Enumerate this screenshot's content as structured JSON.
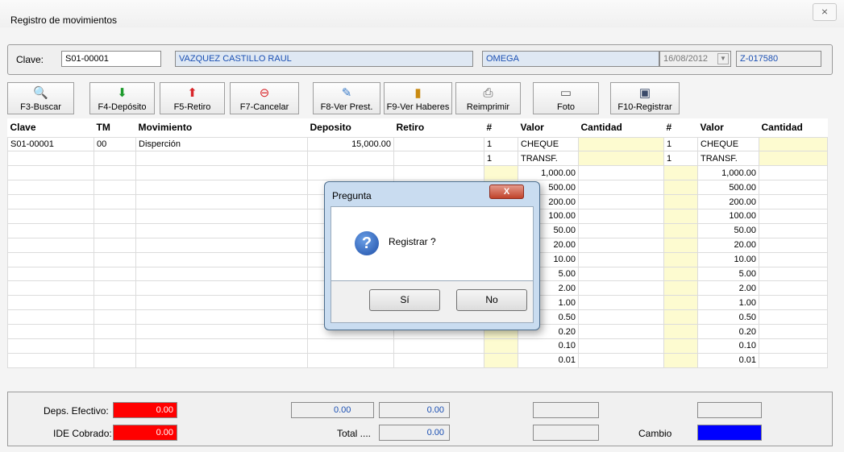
{
  "window": {
    "title": "Registro de movimientos",
    "close_glyph": "⨯"
  },
  "header": {
    "clave_label": "Clave:",
    "clave_value": "S01-00001",
    "name": "VAZQUEZ CASTILLO RAUL",
    "branch": "OMEGA",
    "date": "16/08/2012",
    "code": "Z-017580"
  },
  "toolbar": [
    {
      "label": "F3-Buscar",
      "icon": "search-icon",
      "glyph": "🔍"
    },
    {
      "label": "F4-Depósito",
      "icon": "arrow-down-icon",
      "glyph": "⬇"
    },
    {
      "label": "F5-Retiro",
      "icon": "arrow-up-icon",
      "glyph": "⬆"
    },
    {
      "label": "F7-Cancelar",
      "icon": "cancel-icon",
      "glyph": "⊖"
    },
    {
      "label": "F8-Ver Prest.",
      "icon": "document-icon",
      "glyph": "✎"
    },
    {
      "label": "F9-Ver Haberes",
      "icon": "bar-chart-icon",
      "glyph": "▮"
    },
    {
      "label": "Reimprimir",
      "icon": "printer-icon",
      "glyph": "⎙"
    },
    {
      "label": "Foto",
      "icon": "camera-icon",
      "glyph": "▭"
    },
    {
      "label": "F10-Registrar",
      "icon": "save-icon",
      "glyph": "▣"
    }
  ],
  "grid": {
    "columns": [
      "Clave",
      "TM",
      "Movimiento",
      "Deposito",
      "Retiro",
      "#",
      "Valor",
      "Cantidad",
      "#",
      "Valor",
      "Cantidad"
    ],
    "rows": [
      {
        "clave": "S01-00001",
        "tm": "00",
        "mov": "Disperción",
        "deposito": "15,000.00",
        "retiro": ""
      }
    ],
    "cash_types": [
      {
        "n": "1",
        "v": "CHEQUE"
      },
      {
        "n": "1",
        "v": "TRANSF."
      }
    ],
    "denominations": [
      "1,000.00",
      "500.00",
      "200.00",
      "100.00",
      "50.00",
      "20.00",
      "10.00",
      "5.00",
      "2.00",
      "1.00",
      "0.50",
      "0.20",
      "0.10",
      "0.01"
    ]
  },
  "footer": {
    "deps_label": "Deps. Efectivo:",
    "deps_value": "0.00",
    "ide_label": "IDE Cobrado:",
    "ide_value": "0.00",
    "v1": "0.00",
    "v2": "0.00",
    "total_label": "Total ....",
    "total_value": "0.00",
    "cambio_label": "Cambio",
    "accent_red": "#ff0000",
    "accent_blue": "#0000ff"
  },
  "dialog": {
    "title": "Pregunta",
    "message": "Registrar ?",
    "yes": "Sí",
    "no": "No",
    "close_glyph": "X",
    "icon": "question-icon",
    "icon_glyph": "?"
  }
}
